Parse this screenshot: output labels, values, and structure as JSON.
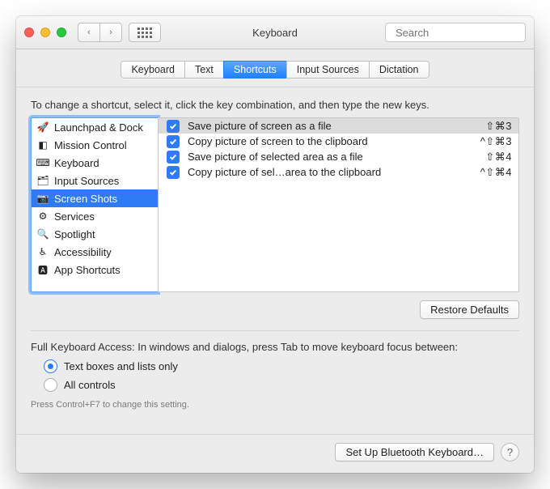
{
  "window": {
    "title": "Keyboard",
    "search_placeholder": "Search"
  },
  "tabs": [
    {
      "label": "Keyboard",
      "selected": false
    },
    {
      "label": "Text",
      "selected": false
    },
    {
      "label": "Shortcuts",
      "selected": true
    },
    {
      "label": "Input Sources",
      "selected": false
    },
    {
      "label": "Dictation",
      "selected": false
    }
  ],
  "instruction": "To change a shortcut, select it, click the key combination, and then type the new keys.",
  "categories": [
    {
      "icon": "rocket-icon",
      "label": "Launchpad & Dock",
      "selected": false
    },
    {
      "icon": "grid-icon",
      "label": "Mission Control",
      "selected": false
    },
    {
      "icon": "keyboard-icon",
      "label": "Keyboard",
      "selected": false
    },
    {
      "icon": "globe-icon",
      "label": "Input Sources",
      "selected": false
    },
    {
      "icon": "camera-icon",
      "label": "Screen Shots",
      "selected": true
    },
    {
      "icon": "gear-icon",
      "label": "Services",
      "selected": false
    },
    {
      "icon": "spotlight-icon",
      "label": "Spotlight",
      "selected": false
    },
    {
      "icon": "accessibility-icon",
      "label": "Accessibility",
      "selected": false
    },
    {
      "icon": "apps-icon",
      "label": "App Shortcuts",
      "selected": false
    }
  ],
  "shortcuts": [
    {
      "checked": true,
      "selected": true,
      "label": "Save picture of screen as a file",
      "keys": "⇧⌘3"
    },
    {
      "checked": true,
      "selected": false,
      "label": "Copy picture of screen to the clipboard",
      "keys": "^⇧⌘3"
    },
    {
      "checked": true,
      "selected": false,
      "label": "Save picture of selected area as a file",
      "keys": "⇧⌘4"
    },
    {
      "checked": true,
      "selected": false,
      "label": "Copy picture of sel…area to the clipboard",
      "keys": "^⇧⌘4"
    }
  ],
  "restore_label": "Restore Defaults",
  "fka": {
    "text": "Full Keyboard Access: In windows and dialogs, press Tab to move keyboard focus between:",
    "options": [
      {
        "label": "Text boxes and lists only",
        "checked": true
      },
      {
        "label": "All controls",
        "checked": false
      }
    ],
    "hint": "Press Control+F7 to change this setting."
  },
  "footer": {
    "bluetooth_label": "Set Up Bluetooth Keyboard…",
    "help_label": "?"
  }
}
